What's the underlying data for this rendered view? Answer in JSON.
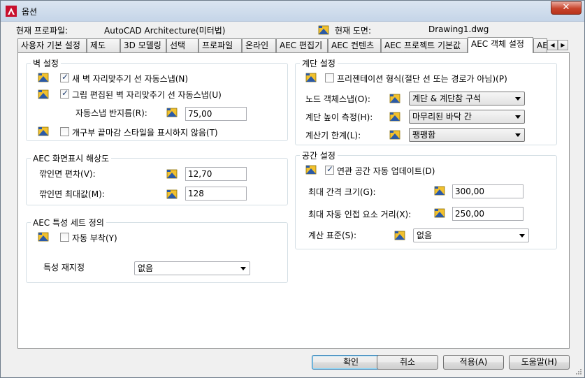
{
  "window": {
    "title": "옵션",
    "close_glyph": "✕"
  },
  "profile": {
    "current_profile_label": "현재 프로파일:",
    "current_profile_value": "AutoCAD Architecture(미터법)",
    "current_drawing_label": "현재 도면:",
    "current_drawing_value": "Drawing1.dwg"
  },
  "tabs": [
    {
      "label": "사용자 기본 설정"
    },
    {
      "label": "제도"
    },
    {
      "label": "3D 모델링"
    },
    {
      "label": "선택"
    },
    {
      "label": "프로파일"
    },
    {
      "label": "온라인"
    },
    {
      "label": "AEC 편집기"
    },
    {
      "label": "AEC 컨텐츠"
    },
    {
      "label": "AEC 프로젝트 기본값"
    },
    {
      "label": "AEC 객체 설정"
    },
    {
      "label": "AEC 표시"
    }
  ],
  "active_tab": "AEC 객체 설정",
  "wall": {
    "title": "벽 설정",
    "autosnap_new": {
      "label": "새 벽 자리맞추기 선 자동스냅(N)",
      "checked": true
    },
    "autosnap_grip": {
      "label": "그립 편집된 벽 자리맞추기 선 자동스냅(U)",
      "checked": true
    },
    "radius_label": "자동스냅 반지름(R):",
    "radius_value": "75,00",
    "opening_endcap": {
      "label": "개구부 끝마감 스타일을 표시하지 않음(T)",
      "checked": false
    }
  },
  "resolution": {
    "title": "AEC 화면표시 해상도",
    "facet_dev_label": "깎인면 편차(V):",
    "facet_dev_value": "12,70",
    "facet_max_label": "깎인면 최대값(M):",
    "facet_max_value": "128"
  },
  "propset": {
    "title": "AEC 특성 세트 정의",
    "auto_attach": {
      "label": "자동 부착(Y)",
      "checked": false
    },
    "reassign_label": "특성 재지정",
    "reassign_value": "없음"
  },
  "stair": {
    "title": "계단 설정",
    "presentation": {
      "label": "프리젠테이션 형식(절단 선 또는 경로가 아님)(P)",
      "checked": false
    },
    "node_label": "노드 객체스냅(O):",
    "node_value": "계단 & 계단참 구석",
    "height_label": "계단 높이 측정(H):",
    "height_value": "마무리된 바닥 간",
    "calc_label": "계산기 한계(L):",
    "calc_value": "팽팽함"
  },
  "space": {
    "title": "공간 설정",
    "auto_update": {
      "label": "연관 공간 자동 업데이트(D)",
      "checked": true
    },
    "max_gap_label": "최대 간격 크기(G):",
    "max_gap_value": "300,00",
    "max_adj_label": "최대 자동 인접 요소 거리(X):",
    "max_adj_value": "250,00",
    "calc_std_label": "계산 표준(S):",
    "calc_std_value": "없음"
  },
  "buttons": {
    "ok": "확인",
    "cancel": "취소",
    "apply": "적용(A)",
    "help": "도움말(H)"
  },
  "colors": {
    "accent": "#c7432b",
    "icon_yellow": "#f2c12e",
    "icon_blue": "#2b5aa6"
  }
}
